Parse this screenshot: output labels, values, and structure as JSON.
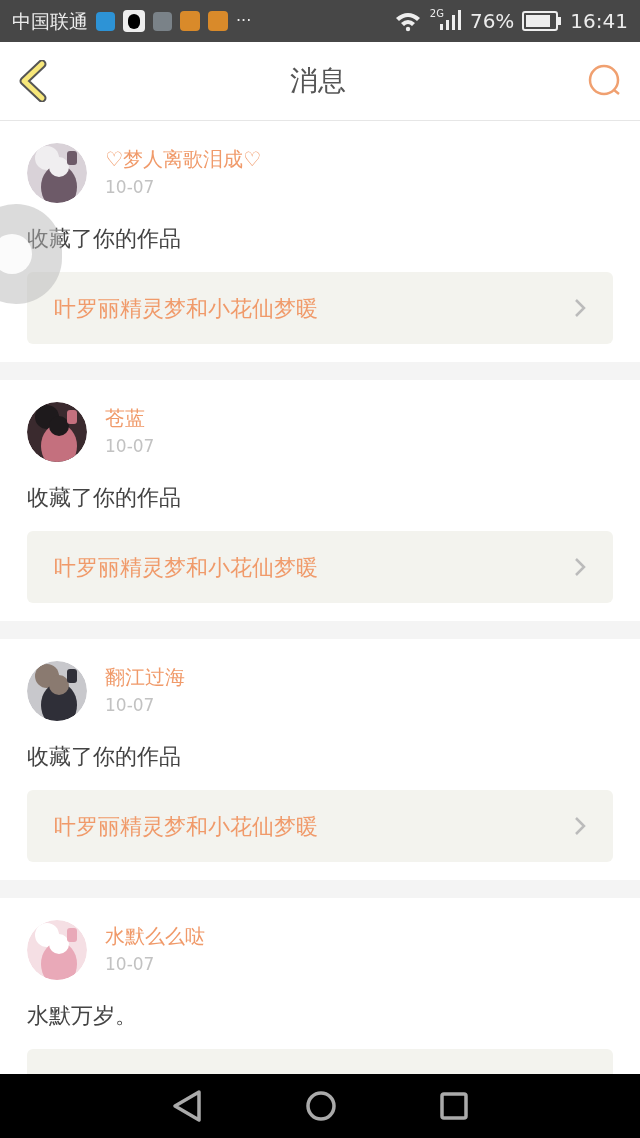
{
  "status_bar": {
    "carrier": "中国联通",
    "more": "···",
    "network": "2G",
    "battery": "76%",
    "time": "16:41"
  },
  "header": {
    "title": "消息"
  },
  "messages": [
    {
      "name": "♡梦人离歌泪成♡",
      "date": "10-07",
      "text": "收藏了你的作品",
      "link": "叶罗丽精灵梦和小花仙梦暖"
    },
    {
      "name": "苍蓝",
      "date": "10-07",
      "text": "收藏了你的作品",
      "link": "叶罗丽精灵梦和小花仙梦暖"
    },
    {
      "name": "翻江过海",
      "date": "10-07",
      "text": "收藏了你的作品",
      "link": "叶罗丽精灵梦和小花仙梦暖"
    },
    {
      "name": "水默么么哒",
      "date": "10-07",
      "text": "水默万岁。"
    }
  ]
}
